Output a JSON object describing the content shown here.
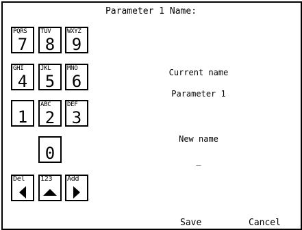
{
  "header": {
    "title": "Parameter 1 Name:"
  },
  "keypad": {
    "k7": {
      "letters": "PQRS",
      "digit": "7"
    },
    "k8": {
      "letters": "TUV",
      "digit": "8"
    },
    "k9": {
      "letters": "WXYZ",
      "digit": "9"
    },
    "k4": {
      "letters": "GHI",
      "digit": "4"
    },
    "k5": {
      "letters": "JKL",
      "digit": "5"
    },
    "k6": {
      "letters": "MNO",
      "digit": "6"
    },
    "k1": {
      "letters": "",
      "digit": "1"
    },
    "k2": {
      "letters": "ABC",
      "digit": "2"
    },
    "k3": {
      "letters": "DEF",
      "digit": "3"
    },
    "k0": {
      "letters": "",
      "digit": "0"
    },
    "del": {
      "label": "Del",
      "icon": "arrow-left-icon"
    },
    "mode": {
      "label": "123",
      "icon": "arrow-up-icon"
    },
    "add": {
      "label": "Add",
      "icon": "arrow-right-icon"
    }
  },
  "current": {
    "label": "Current name",
    "value": "Parameter 1"
  },
  "new_name": {
    "label": "New name",
    "value": "_"
  },
  "footer": {
    "save_label": "Save",
    "cancel_label": "Cancel"
  }
}
